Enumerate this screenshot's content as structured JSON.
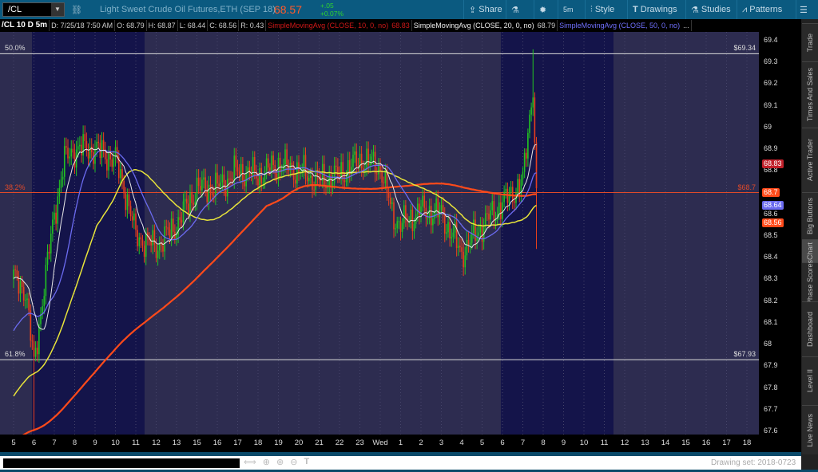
{
  "header": {
    "symbol": "/CL",
    "description": "Light Sweet Crude Oil Futures,ETH (SEP 18)",
    "last": "68.57",
    "change": "+.05",
    "change_pct": "+0.07%"
  },
  "toolbar": {
    "share": "Share",
    "interval": "5m",
    "style": "Style",
    "drawings": "Drawings",
    "studies": "Studies",
    "patterns": "Patterns"
  },
  "legend": {
    "title": "/CL 10 D 5m",
    "date": "D: 7/25/18 7:50 AM",
    "open": "O: 68.79",
    "high": "H: 68.87",
    "low": "L: 68.44",
    "close": "C: 68.56",
    "range": "R: 0.43",
    "sma10": "SimpleMovingAvg (CLOSE, 10, 0, no)",
    "sma10_val": "68.83",
    "sma20": "SimpleMovingAvg (CLOSE, 20, 0, no)",
    "sma20_val": "68.79",
    "sma50": "SimpleMovingAvg (CLOSE, 50, 0, no)",
    "more": "..."
  },
  "colors": {
    "up": "#22c322",
    "down": "#e8401c",
    "sma_white": "#e8e8e8",
    "sma_blue": "#6b6bf0",
    "sma_yellow": "#e8e43a",
    "sma_red": "#ff4a1a",
    "band_light": "#2d2c50",
    "band_dark": "#14144a"
  },
  "fib": [
    {
      "pct": "50.0%",
      "price": "$69.34",
      "value": 69.34,
      "color": "#dddddd"
    },
    {
      "pct": "38.2%",
      "price": "$68.7",
      "value": 68.7,
      "color": "#e04a2a"
    },
    {
      "pct": "61.8%",
      "price": "$67.93",
      "value": 67.93,
      "color": "#dddddd"
    }
  ],
  "price_tags": [
    {
      "text": "68.83",
      "value": 68.83,
      "color": "#c0202a"
    },
    {
      "text": "68.7",
      "value": 68.7,
      "color": "#ff4a1a"
    },
    {
      "text": "68.64",
      "value": 68.64,
      "color": "#6b6bf0"
    },
    {
      "text": "68.56",
      "value": 68.56,
      "color": "#ff4a1a"
    }
  ],
  "chart_data": {
    "type": "candlestick",
    "ylim": [
      67.55,
      69.45
    ],
    "y_ticks": [
      "69.4",
      "69.3",
      "69.2",
      "69.1",
      "69",
      "68.9",
      "68.8",
      "68.7",
      "68.6",
      "68.5",
      "68.4",
      "68.3",
      "68.2",
      "68.1",
      "68",
      "67.9",
      "67.8",
      "67.7",
      "67.6"
    ],
    "x_ticks": [
      "5",
      "6",
      "7",
      "8",
      "9",
      "10",
      "11",
      "12",
      "13",
      "15",
      "16",
      "17",
      "18",
      "19",
      "20",
      "21",
      "22",
      "23",
      "Wed",
      "1",
      "2",
      "3",
      "4",
      "5",
      "6",
      "7",
      "8",
      "9",
      "10",
      "11",
      "12",
      "13",
      "14",
      "15",
      "16",
      "17",
      "18"
    ],
    "hourly_path": [
      [
        0,
        68.3
      ],
      [
        0.6,
        68.25
      ],
      [
        1,
        67.9
      ],
      [
        1.4,
        68.2
      ],
      [
        2,
        68.6
      ],
      [
        2.5,
        68.85
      ],
      [
        3,
        68.9
      ],
      [
        4,
        68.9
      ],
      [
        5,
        68.85
      ],
      [
        5.5,
        68.7
      ],
      [
        6,
        68.5
      ],
      [
        7,
        68.45
      ],
      [
        8,
        68.55
      ],
      [
        9,
        68.72
      ],
      [
        10,
        68.72
      ],
      [
        11,
        68.8
      ],
      [
        12,
        68.78
      ],
      [
        13,
        68.83
      ],
      [
        14,
        68.8
      ],
      [
        15,
        68.75
      ],
      [
        16,
        68.78
      ],
      [
        17,
        68.85
      ],
      [
        18,
        68.82
      ],
      [
        18.6,
        68.6
      ],
      [
        19,
        68.55
      ],
      [
        20,
        68.62
      ],
      [
        21,
        68.6
      ],
      [
        22,
        68.42
      ],
      [
        23,
        68.55
      ],
      [
        24,
        68.65
      ],
      [
        25,
        68.75
      ],
      [
        25.5,
        69.2
      ],
      [
        25.7,
        68.56
      ]
    ]
  },
  "footer": {
    "drawing_set": "Drawing set: 2018-0723"
  },
  "sidebar": [
    "Trade",
    "Times And Sales",
    "Active Trader",
    "Big Buttons",
    "Chart",
    "Phase Scores",
    "Dashboard",
    "Level II",
    "Live News"
  ]
}
